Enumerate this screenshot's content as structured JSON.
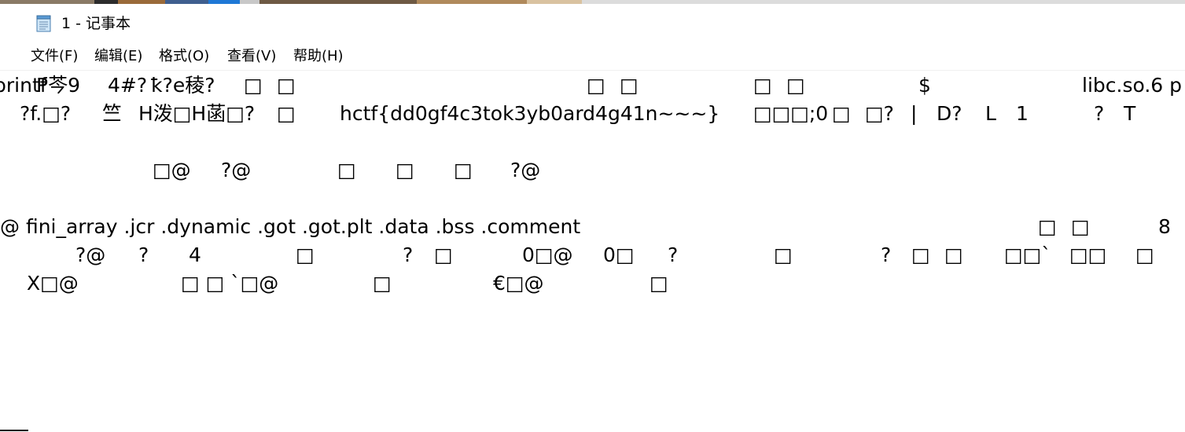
{
  "window": {
    "title": "1 - 记事本",
    "icon": "notepad-icon"
  },
  "menu": [
    {
      "label": "文件(F)"
    },
    {
      "label": "编辑(E)"
    },
    {
      "label": "格式(O)"
    },
    {
      "label": "查看(V)"
    },
    {
      "label": "帮助(H)"
    }
  ],
  "editor": {
    "lines": [
      [
        "printf",
        "P芩9",
        "4#?",
        "ꝁ?e稜?",
        "□",
        "□",
        "□",
        "□",
        "□",
        "□",
        "$",
        "libc.so.6 p"
      ],
      [
        "?f.□?",
        "竺",
        "H泼□H菡□?",
        "□",
        "hctf{dd0gf4c3tok3yb0ard4g41n~~~}",
        "□□□;0",
        "□",
        "□?",
        "|",
        "D?",
        "L",
        "1",
        "?",
        "T"
      ],
      [
        "□@",
        "?@",
        "□",
        "□",
        "□",
        "?@"
      ],
      [
        "@ fini_array .jcr .dynamic .got .got.plt .data .bss .comment",
        "□",
        "□",
        "8"
      ],
      [
        "?@",
        "?",
        "4",
        "□",
        "?",
        "□",
        "0□@",
        "0□",
        "?",
        "□",
        "?",
        "□",
        "□",
        "□□`",
        "□□",
        "□"
      ],
      [
        "X□@",
        "□ □ `□@",
        "□",
        "€□@",
        "□"
      ]
    ]
  },
  "colors": {
    "background": "#ffffff",
    "text": "#000000",
    "top_strip": [
      "#8a7a66",
      "#2c2c2c",
      "#9a6a3a",
      "#3f5f8f",
      "#1e78d6",
      "#c8c8c8",
      "#6e5a44",
      "#b08a5c",
      "#d9c2a0",
      "#dcdcdc"
    ]
  }
}
